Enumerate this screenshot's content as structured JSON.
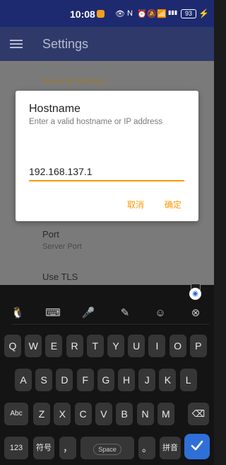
{
  "status_bar": {
    "time": "10:08",
    "battery": "93"
  },
  "app_bar": {
    "title": "Settings"
  },
  "content": {
    "section_header": "General Settings",
    "port_title": "Port",
    "port_subtitle": "Server Port",
    "tls_title": "Use TLS"
  },
  "dialog": {
    "title": "Hostname",
    "message": "Enter a valid hostname or IP address",
    "input_value": "192.168.137.1",
    "cancel_label": "取消",
    "ok_label": "确定"
  },
  "keyboard": {
    "row1": [
      "Q",
      "W",
      "E",
      "R",
      "T",
      "Y",
      "U",
      "I",
      "O",
      "P"
    ],
    "row2": [
      "A",
      "S",
      "D",
      "F",
      "G",
      "H",
      "J",
      "K",
      "L"
    ],
    "row3": [
      "Z",
      "X",
      "C",
      "V",
      "B",
      "N",
      "M"
    ],
    "shift_label": "Abc",
    "numbers_label": "123",
    "symbols_label": "符号",
    "comma_label": "，",
    "space_label": "Space",
    "period_label": "。",
    "pinyin_label": "拼音",
    "colors": {
      "enter": "#2e6fd8",
      "accent": "#ff9800"
    }
  }
}
